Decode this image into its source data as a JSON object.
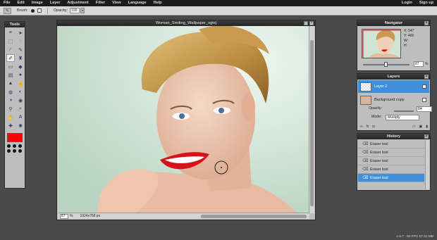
{
  "menu": {
    "items": [
      "File",
      "Edit",
      "Image",
      "Layer",
      "Adjustment",
      "Filter",
      "View",
      "Language",
      "Help"
    ],
    "login": "Login",
    "signup": "Sign up"
  },
  "options": {
    "brush_label": "Brush:",
    "opacity_label": "Opacity:",
    "opacity_value": "100"
  },
  "document": {
    "title": "Woman_Smiling_Wallpaper_sgtx|",
    "zoom": "87",
    "zoom_unit": "%",
    "size": "1024x768 px"
  },
  "navigator": {
    "title": "Navigator",
    "x_label": "X:",
    "x_value": "547",
    "y_label": "Y:",
    "y_value": "466",
    "w_label": "W:",
    "h_label": "H:",
    "zoom": "87",
    "zoom_unit": "%"
  },
  "layers": {
    "title": "Layers",
    "items": [
      {
        "name": "Layer 2",
        "selected": true
      },
      {
        "name": "Background copy",
        "selected": false
      }
    ],
    "opacity_label": "Opacity:",
    "opacity_value": "84",
    "mode_label": "Mode:",
    "mode_value": "Multiply"
  },
  "history": {
    "title": "History",
    "items": [
      {
        "label": "Eraser tool",
        "selected": false
      },
      {
        "label": "Eraser tool",
        "selected": false
      },
      {
        "label": "Eraser tool",
        "selected": false
      },
      {
        "label": "Eraser tool",
        "selected": false
      },
      {
        "label": "Eraser tool",
        "selected": true
      }
    ]
  },
  "tools": {
    "title": "Tools",
    "icons": [
      "crop-icon",
      "move-icon",
      "marquee-icon",
      "lasso-icon",
      "wand-icon",
      "pencil-icon",
      "brush-icon",
      "clone-icon",
      "eraser-icon",
      "bucket-icon",
      "gradient-icon",
      "blur-icon",
      "sharpen-icon",
      "smudge-icon",
      "sponge-icon",
      "dodge-icon",
      "burn-icon",
      "red-eye-icon",
      "picker-icon",
      "zoom-icon",
      "hand-icon",
      "text-icon",
      "spot-heal-icon",
      "bloat-icon"
    ],
    "foreground_color": "#ff0000"
  },
  "status": {
    "version": "v 6.7 - 80 FPS 67.31 MB"
  },
  "colors": {
    "accent": "#3f8fd9",
    "menubar": "#1c1c1c",
    "background": "#4a4a4a"
  }
}
